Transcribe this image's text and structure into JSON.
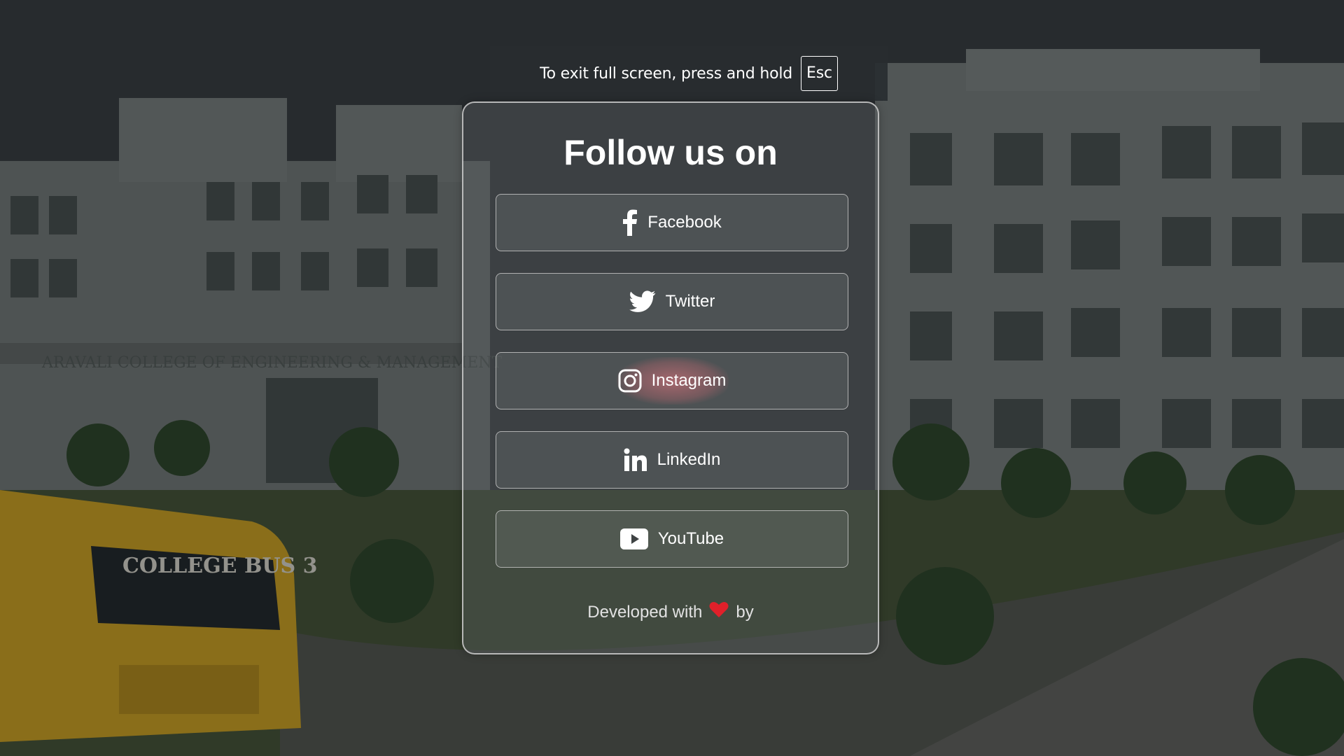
{
  "fullscreen_notice": {
    "text": "To exit full screen, press and hold",
    "key": "Esc"
  },
  "card": {
    "title": "Follow us on",
    "buttons": [
      {
        "label": "Facebook",
        "icon": "facebook-icon"
      },
      {
        "label": "Twitter",
        "icon": "twitter-icon"
      },
      {
        "label": "Instagram",
        "icon": "instagram-icon"
      },
      {
        "label": "LinkedIn",
        "icon": "linkedin-icon"
      },
      {
        "label": "YouTube",
        "icon": "youtube-icon"
      }
    ],
    "footer": {
      "prefix": "Developed with",
      "icon": "heart-icon",
      "suffix": "by"
    }
  },
  "background": {
    "bus_text": "COLLEGE BUS 3",
    "building_sign": "ARAVALI COLLEGE OF ENGINEERING & MANAGEMENT"
  },
  "colors": {
    "heart": "#e0202a",
    "instagram_glow": "#f07882",
    "bus": "#e6b422"
  }
}
